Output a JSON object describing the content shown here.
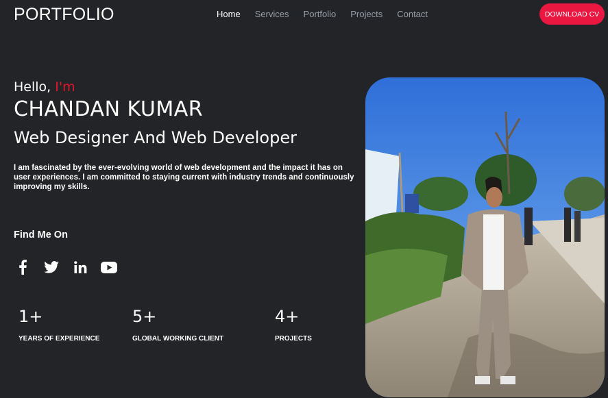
{
  "header": {
    "logo": "PORTFOLIO",
    "nav": [
      "Home",
      "Services",
      "Portfolio",
      "Projects",
      "Contact"
    ],
    "cv_button": "DOWNLOAD CV"
  },
  "hero": {
    "hello": "Hello,",
    "im": "I'm",
    "name": "CHANDAN KUMAR",
    "role": "Web Designer And Web Developer",
    "intro": "I am fascinated by the ever-evolving world of web development and the impact it has on user experiences. I am committed to staying current with industry trends and continuously improving my skills.",
    "find_me": "Find Me On",
    "socials": [
      "facebook-icon",
      "twitter-icon",
      "linkedin-icon",
      "youtube-icon"
    ]
  },
  "stats": [
    {
      "value": "1+",
      "label": "YEARS OF EXPERIENCE"
    },
    {
      "value": "5+",
      "label": "GLOBAL WORKING CLIENT"
    },
    {
      "value": "4+",
      "label": "PROJECTS"
    }
  ],
  "colors": {
    "accent": "#ea1741",
    "background": "#222428"
  }
}
